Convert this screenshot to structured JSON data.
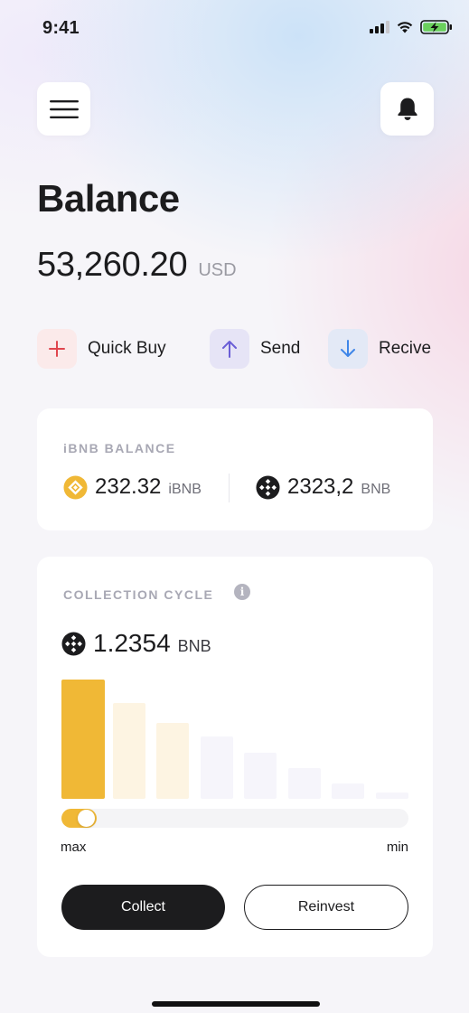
{
  "status_bar": {
    "time": "9:41"
  },
  "header": {
    "title": "Balance"
  },
  "balance": {
    "amount": "53,260.20",
    "currency": "USD"
  },
  "actions": [
    {
      "label": "Quick Buy",
      "icon": "plus-icon",
      "bg": "#fbeaea",
      "color": "#e0464e"
    },
    {
      "label": "Send",
      "icon": "arrow-up-icon",
      "bg": "#e6e4f6",
      "color": "#6a5ed6"
    },
    {
      "label": "Recive",
      "icon": "arrow-down-icon",
      "bg": "#e3e9f6",
      "color": "#3f86e8"
    }
  ],
  "ibnb_card": {
    "label": "iBNB BALANCE",
    "ibnb": {
      "value": "232.32",
      "unit": "iBNB",
      "icon": "ibnb-coin-icon",
      "color": "#f0b836"
    },
    "bnb": {
      "value": "2323,2",
      "unit": "BNB",
      "icon": "bnb-coin-icon",
      "color": "#1c1c1e"
    }
  },
  "cycle_card": {
    "label": "COLLECTION CYCLE",
    "info_icon": "i",
    "amount": {
      "value": "1.2354",
      "unit": "BNB",
      "icon": "bnb-coin-icon"
    },
    "chart_data": {
      "type": "bar",
      "values": [
        1.0,
        0.8,
        0.64,
        0.52,
        0.39,
        0.26,
        0.13,
        0.05
      ],
      "colors": [
        "#f0b836",
        "#fdf4e2",
        "#fdf4e2",
        "#f6f5fb",
        "#f6f5fb",
        "#f6f5fb",
        "#f6f5fb",
        "#f6f5fb"
      ]
    },
    "slider": {
      "value": 0.09,
      "min_label": "max",
      "max_label": "min"
    },
    "buttons": {
      "collect": "Collect",
      "reinvest": "Reinvest"
    }
  },
  "colors": {
    "accent": "#f0b836",
    "dark": "#1c1c1e"
  }
}
